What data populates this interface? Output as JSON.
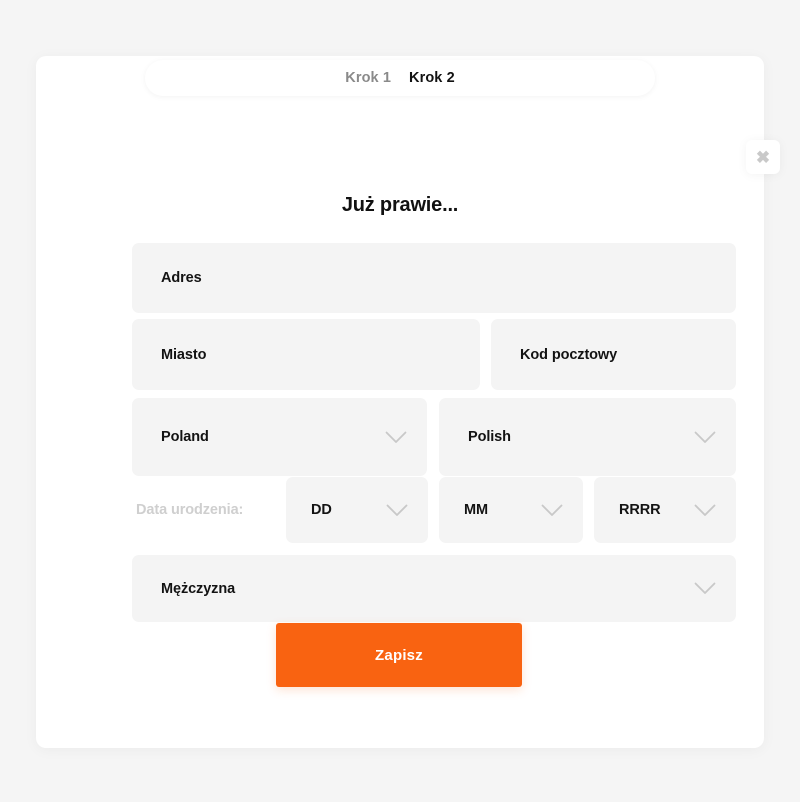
{
  "steps": {
    "tabs": [
      {
        "label": "Krok 1",
        "state": "inactive"
      },
      {
        "label": "Krok 2",
        "state": "active"
      }
    ]
  },
  "dialog": {
    "title": "Już prawie...",
    "close_icon": "close-icon",
    "close_glyph": "✖"
  },
  "form": {
    "address": {
      "label": "Adres",
      "placeholder": "Adres",
      "value": ""
    },
    "city": {
      "label": "Miasto",
      "placeholder": "Miasto",
      "value": ""
    },
    "postcode": {
      "label": "Kod pocztowy",
      "placeholder": "Kod pocztowy",
      "value": ""
    },
    "country": {
      "label": "Poland",
      "value": "Poland"
    },
    "language": {
      "label": "Polish",
      "value": "Polish"
    },
    "birthdate": {
      "label": "Data urodzenia:",
      "day": "DD",
      "month": "MM",
      "year": "RRRR"
    },
    "gender": {
      "label": "Mężczyzna",
      "value": "Mężczyzna"
    },
    "chevron_icon": "chevron-down-icon"
  },
  "actions": {
    "submit_label": "Zapisz"
  },
  "colors": {
    "accent": "#f96311",
    "page_background": "#f5f5f5",
    "card_background": "#ffffff",
    "field_background": "#f4f4f4",
    "text_primary": "#121212",
    "text_muted": "#8a8a8a",
    "text_placeholder_muted": "#cfcfcf"
  }
}
